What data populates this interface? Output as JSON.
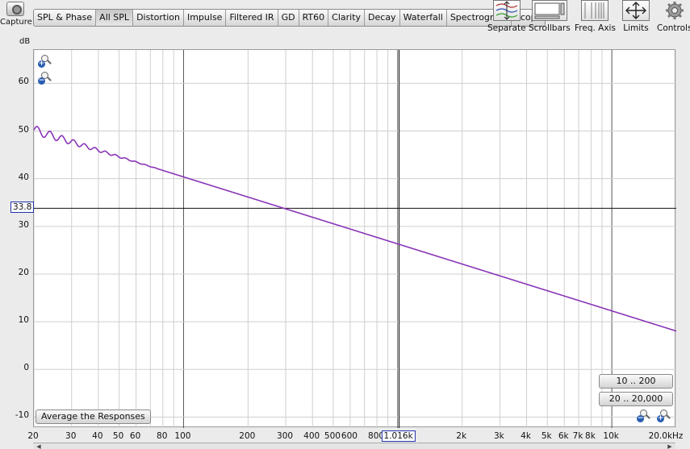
{
  "toolbar": {
    "capture_label": "Capture",
    "tabs": [
      {
        "label": "SPL & Phase",
        "active": false
      },
      {
        "label": "All SPL",
        "active": true
      },
      {
        "label": "Distortion",
        "active": false
      },
      {
        "label": "Impulse",
        "active": false
      },
      {
        "label": "Filtered IR",
        "active": false
      },
      {
        "label": "GD",
        "active": false
      },
      {
        "label": "RT60",
        "active": false
      },
      {
        "label": "Clarity",
        "active": false
      },
      {
        "label": "Decay",
        "active": false
      },
      {
        "label": "Waterfall",
        "active": false
      },
      {
        "label": "Spectrogram",
        "active": false
      },
      {
        "label": "Scope",
        "active": false
      }
    ],
    "tools": {
      "separate": "Separate",
      "scrollbars": "Scrollbars",
      "freq_axis": "Freq. Axis",
      "limits": "Limits",
      "controls": "Controls"
    }
  },
  "graph": {
    "y_unit": "dB",
    "y_ticks": [
      "60",
      "50",
      "40",
      "30",
      "20",
      "10",
      "0",
      "-10"
    ],
    "x_ticks": [
      "20",
      "30",
      "40",
      "50",
      "60",
      "80",
      "100",
      "200",
      "300",
      "400",
      "500",
      "600",
      "800",
      "2k",
      "3k",
      "4k",
      "5k",
      "6k",
      "7k",
      "8k",
      "10k",
      "20.0kHz"
    ],
    "cursor_y_value": "33.8",
    "cursor_x_value": "1.016k",
    "trace_color": "#8a35b8"
  },
  "buttons": {
    "average": "Average the Responses",
    "range_10_200": "10 .. 200",
    "range_20_20000": "20 .. 20,000"
  }
}
